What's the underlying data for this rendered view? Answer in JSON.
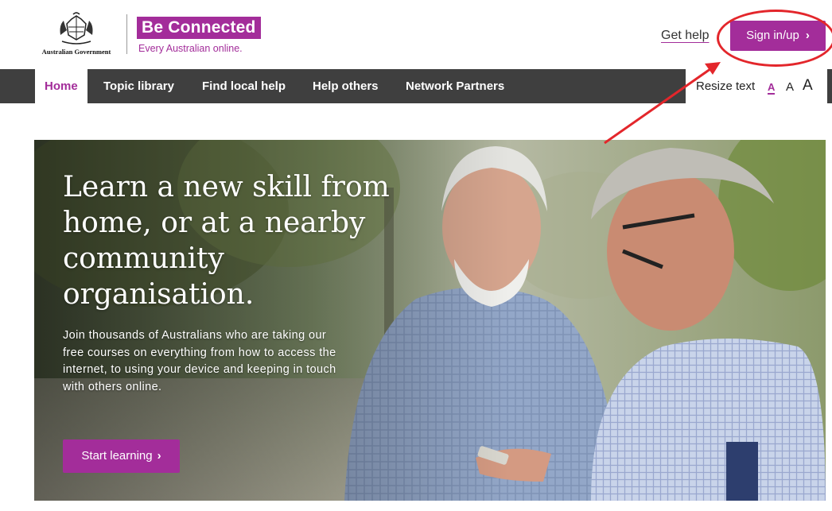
{
  "header": {
    "gov_logo_text": "Australian Government",
    "brand_title": "Be Connected",
    "brand_tagline": "Every Australian online.",
    "get_help": "Get help",
    "sign_in": "Sign in/up",
    "chevron": "›"
  },
  "nav": {
    "items": [
      {
        "label": "Home",
        "active": true
      },
      {
        "label": "Topic library"
      },
      {
        "label": "Find local help"
      },
      {
        "label": "Help others"
      },
      {
        "label": "Network Partners"
      }
    ],
    "resize_label": "Resize text",
    "resize_small": "A",
    "resize_medium": "A",
    "resize_large": "A"
  },
  "hero": {
    "title": "Learn a new skill from home, or at a nearby community organisation.",
    "body": "Join thousands of Australians who are taking our free courses on everything from how to access the internet, to using your device and keeping in touch with others online.",
    "cta": "Start learning",
    "chevron": "›"
  },
  "colors": {
    "brand": "#a32d9a",
    "nav_bg": "#3f3f3f",
    "annotation": "#e3262b"
  }
}
